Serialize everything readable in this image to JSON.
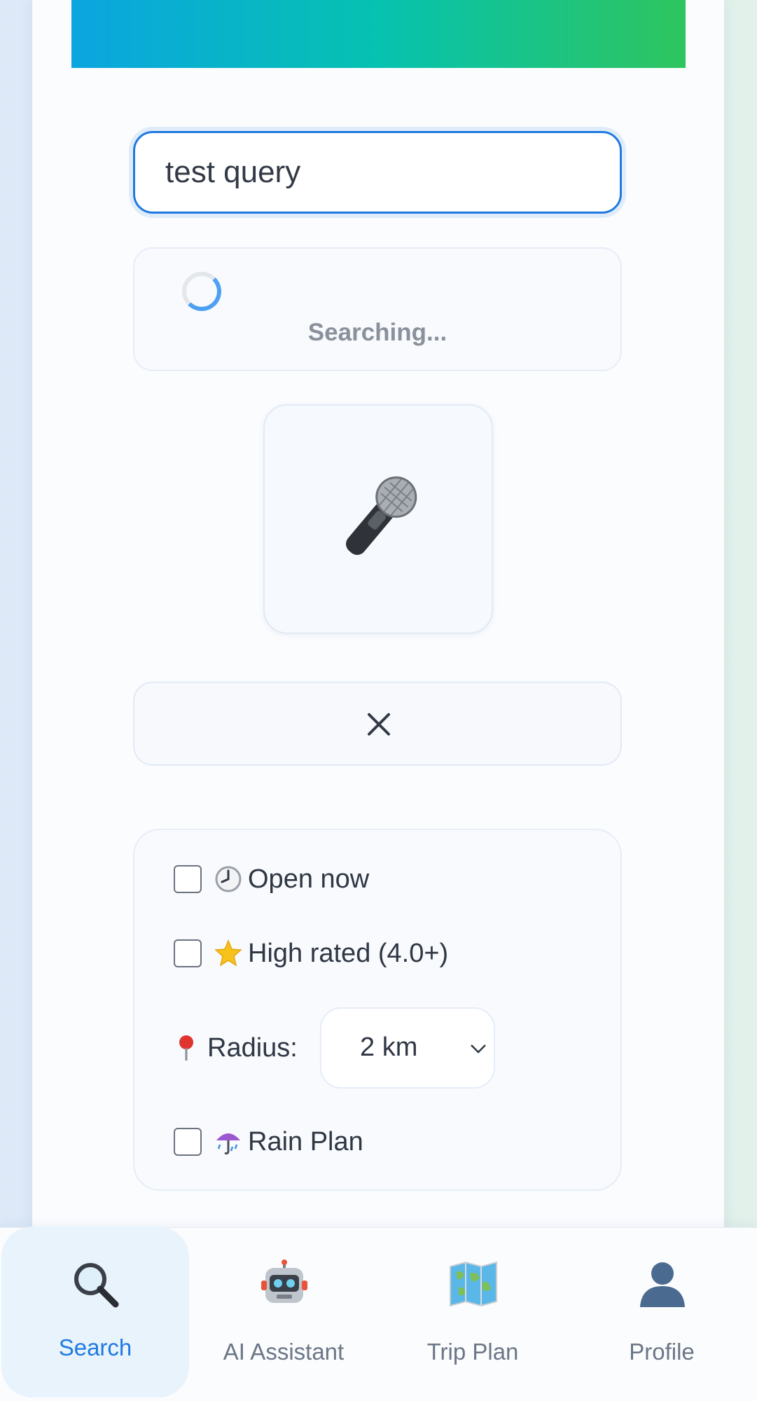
{
  "search": {
    "value": "test query"
  },
  "loading": {
    "text": "Searching..."
  },
  "mic": {
    "icon": "microphone-icon"
  },
  "clear": {
    "icon": "close-icon"
  },
  "filters": {
    "open_now": {
      "label": "Open now",
      "icon": "clock-icon",
      "checked": false
    },
    "high_rated": {
      "label": "High rated (4.0+)",
      "icon": "star-icon",
      "checked": false
    },
    "radius": {
      "label": "Radius:",
      "icon": "pin-icon",
      "selected": "2 km"
    },
    "rain_plan": {
      "label": "Rain Plan",
      "icon": "umbrella-icon",
      "checked": false
    }
  },
  "nav": {
    "items": [
      {
        "label": "Search",
        "icon": "search-icon",
        "active": true
      },
      {
        "label": "AI Assistant",
        "icon": "robot-icon",
        "active": false
      },
      {
        "label": "Trip Plan",
        "icon": "map-icon",
        "active": false
      },
      {
        "label": "Profile",
        "icon": "user-icon",
        "active": false
      }
    ]
  },
  "colors": {
    "accent": "#1f7ae0",
    "banner_start": "#0ba5e0",
    "banner_end": "#2ec55e"
  }
}
